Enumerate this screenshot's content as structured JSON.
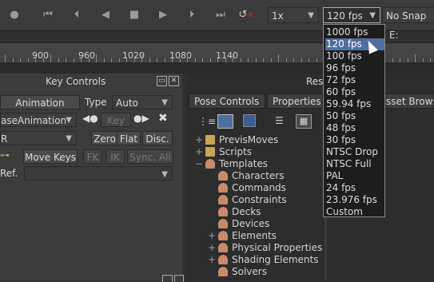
{
  "transport": {
    "speed_value": "1x",
    "fps_value": "120 fps",
    "snap_value": "No Snap",
    "e_label": "E:"
  },
  "ruler": {
    "ticks": [
      "900",
      "960",
      "1020",
      "1080",
      "1140"
    ]
  },
  "key_controls": {
    "title": "Key Controls",
    "animation_button": "Animation",
    "type_label": "Type",
    "type_value": "Auto",
    "layer_value": "aseAnimation",
    "key_button": "Key",
    "r_value": "R",
    "zero_button": "Zero",
    "flat_button": "Flat",
    "disc_button": "Disc.",
    "move_keys_button": "Move Keys",
    "fk_button": "FK",
    "ik_button": "IK",
    "sync_all_button": "Sync. All",
    "ref_label": "Ref."
  },
  "resources": {
    "title_fragment": "Res",
    "tabs": [
      "Pose Controls",
      "Properties",
      "sset Brows"
    ],
    "tree": [
      {
        "label": "PrevisMoves",
        "icon": "folder-icon",
        "expander": "+",
        "indent": 0
      },
      {
        "label": "Scripts",
        "icon": "folder-icon",
        "expander": "+",
        "indent": 0
      },
      {
        "label": "Templates",
        "icon": "template-icon",
        "expander": "−",
        "indent": 0
      },
      {
        "label": "Characters",
        "icon": "template-icon",
        "expander": "",
        "indent": 1
      },
      {
        "label": "Commands",
        "icon": "template-icon",
        "expander": "",
        "indent": 1
      },
      {
        "label": "Constraints",
        "icon": "template-icon",
        "expander": "",
        "indent": 1
      },
      {
        "label": "Decks",
        "icon": "template-icon",
        "expander": "",
        "indent": 1
      },
      {
        "label": "Devices",
        "icon": "template-icon",
        "expander": "",
        "indent": 1
      },
      {
        "label": "Elements",
        "icon": "template-icon",
        "expander": "+",
        "indent": 1
      },
      {
        "label": "Physical Properties",
        "icon": "template-icon",
        "expander": "+",
        "indent": 1
      },
      {
        "label": "Shading Elements",
        "icon": "template-icon",
        "expander": "+",
        "indent": 1
      },
      {
        "label": "Solvers",
        "icon": "template-icon",
        "expander": "",
        "indent": 1
      }
    ]
  },
  "fps_options": [
    "1000 fps",
    "120 fps",
    "100 fps",
    "96 fps",
    "72 fps",
    "60 fps",
    "59.94 fps",
    "50 fps",
    "48 fps",
    "30 fps",
    "NTSC Drop",
    "NTSC Full",
    "PAL",
    "24 fps",
    "23.976 fps",
    "Custom"
  ],
  "fps_selected": "120 fps",
  "colors": {
    "highlight": "#4f6fa0",
    "panel": "#3c3c3c",
    "background": "#303030"
  }
}
